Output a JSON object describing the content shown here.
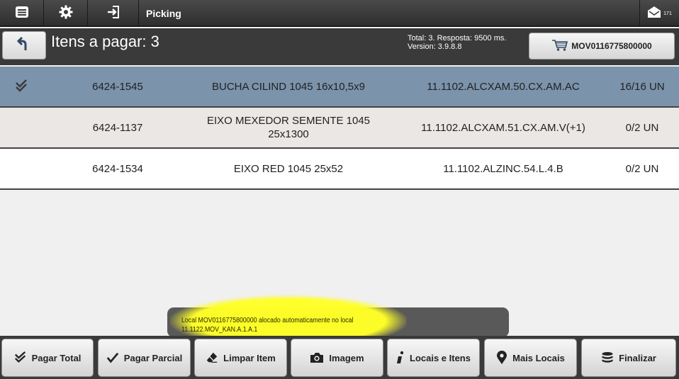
{
  "topbar": {
    "title": "Picking",
    "menu_icon": "menu-icon",
    "settings_icon": "gear-icon",
    "login_icon": "sign-in-icon",
    "mail_icon": "mail-icon",
    "mail_count": "171"
  },
  "header": {
    "title": "Itens a pagar: 3",
    "total_line": "Total: 3. Resposta: 9500 ms.",
    "version_line": "Version: 3.9.8.8",
    "cart_label": "MOV0116775800000",
    "back_icon": "undo-arrow-icon",
    "cart_icon": "cart-icon"
  },
  "items": [
    {
      "checked": "✔",
      "code": "6424-1545",
      "description": "BUCHA CILIND 1045 16x10,5x9",
      "location": "11.1102.ALCXAM.50.CX.AM.AC",
      "quantity": "16/16 UN"
    },
    {
      "checked": "",
      "code": "6424-1137",
      "description": "EIXO MEXEDOR SEMENTE 1045 25x1300",
      "location": "11.1102.ALCXAM.51.CX.AM.V(+1)",
      "quantity": "0/2 UN"
    },
    {
      "checked": "",
      "code": "6424-1534",
      "description": "EIXO RED 1045 25x52",
      "location": "11.1102.ALZINC.54.L.4.B",
      "quantity": "0/2 UN"
    }
  ],
  "toast": {
    "line1": "Local MOV0116775800000 alocado automaticamente no local",
    "line2": "11.1122.MOV_KAN.A.1.A.1",
    "highlight_color": "#ffff28"
  },
  "actions": [
    {
      "label": "Pagar Total",
      "icon": "double-check-icon"
    },
    {
      "label": "Pagar Parcial",
      "icon": "check-icon"
    },
    {
      "label": "Limpar Item",
      "icon": "eraser-icon"
    },
    {
      "label": "Imagem",
      "icon": "camera-icon"
    },
    {
      "label": "Locais e Itens",
      "icon": "info-icon"
    },
    {
      "label": "Mais Locais",
      "icon": "map-pin-icon"
    },
    {
      "label": "Finalizar",
      "icon": "database-icon"
    }
  ],
  "colors": {
    "selected_row": "#7b93ab",
    "alt_row": "#ebe7e5",
    "bar_dark": "#3a3a3a"
  }
}
